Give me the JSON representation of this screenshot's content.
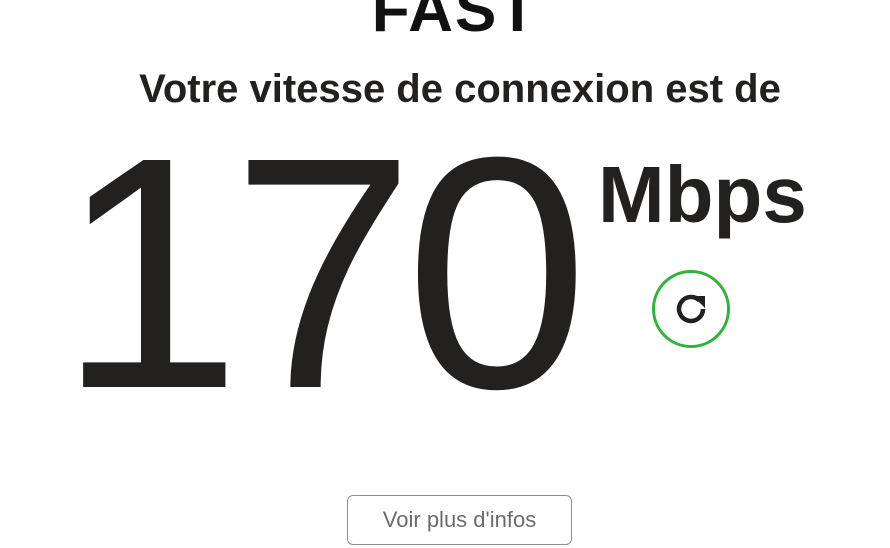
{
  "header": {
    "logo_text": "FAST"
  },
  "result": {
    "headline": "Votre vitesse de connexion est de",
    "speed_value": "170",
    "speed_units": "Mbps"
  },
  "actions": {
    "refresh_icon": "refresh-icon",
    "more_info_label": "Voir plus d'infos"
  },
  "colors": {
    "text": "#222120",
    "accent_green": "#2fb33a",
    "button_border": "#8d8d8d",
    "button_text": "#6b6b6b"
  }
}
